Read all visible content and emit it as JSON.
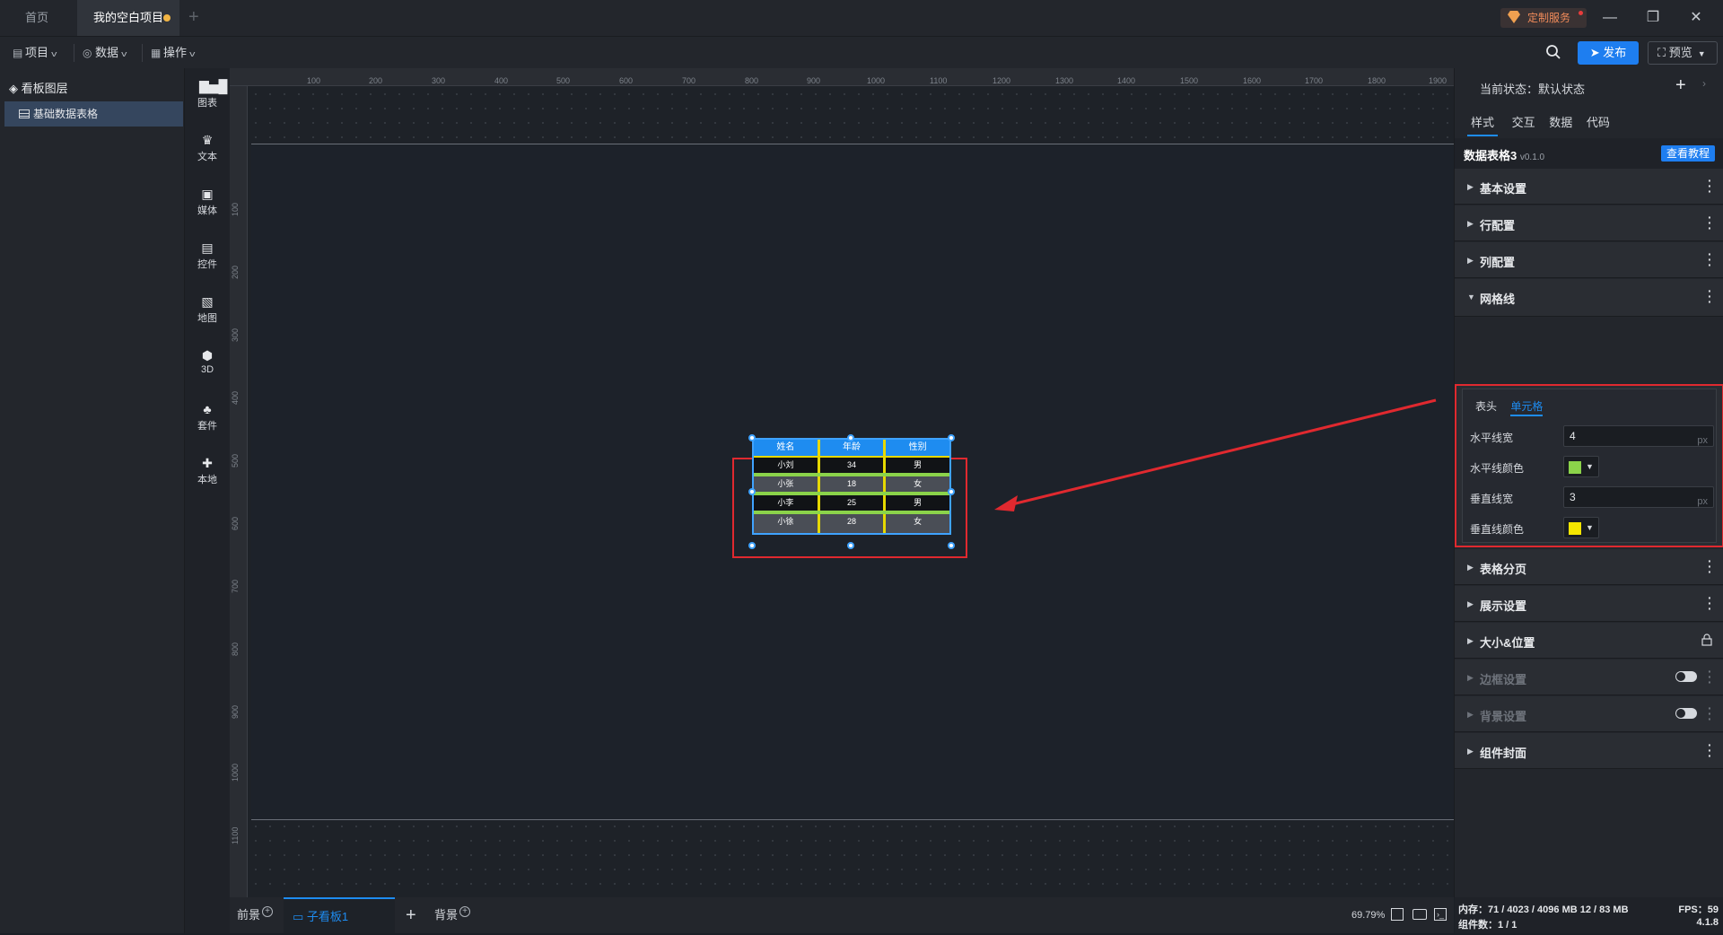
{
  "titlebar": {
    "tabs": [
      {
        "label": "首页"
      },
      {
        "label": "我的空白项目"
      }
    ],
    "custom_service": "定制服务"
  },
  "toolbar": {
    "menus": [
      {
        "label": "项目"
      },
      {
        "label": "数据"
      },
      {
        "label": "操作"
      }
    ],
    "publish": "发布",
    "preview": "预览"
  },
  "layers": {
    "title": "看板图层",
    "items": [
      {
        "label": "基础数据表格"
      }
    ]
  },
  "categories": [
    {
      "label": "图表",
      "icon": "chart-icon"
    },
    {
      "label": "文本",
      "icon": "text-icon"
    },
    {
      "label": "媒体",
      "icon": "media-icon"
    },
    {
      "label": "控件",
      "icon": "control-icon"
    },
    {
      "label": "地图",
      "icon": "map-icon"
    },
    {
      "label": "3D",
      "icon": "cube-icon"
    },
    {
      "label": "套件",
      "icon": "kit-icon"
    },
    {
      "label": "本地",
      "icon": "puzzle-icon"
    }
  ],
  "ruler": {
    "top": [
      "100",
      "200",
      "300",
      "400",
      "500",
      "600",
      "700",
      "800",
      "900",
      "1000",
      "1100",
      "1200",
      "1300",
      "1400",
      "1500",
      "1600",
      "1700",
      "1800",
      "1900"
    ],
    "left": [
      "100",
      "200",
      "300",
      "400",
      "500",
      "600",
      "700",
      "800",
      "900",
      "1000",
      "1100"
    ]
  },
  "table": {
    "headers": [
      "姓名",
      "年龄",
      "性别"
    ],
    "rows": [
      [
        "小刘",
        "34",
        "男"
      ],
      [
        "小张",
        "18",
        "女"
      ],
      [
        "小李",
        "25",
        "男"
      ],
      [
        "小徐",
        "28",
        "女"
      ]
    ],
    "colors": {
      "header_bg": "#1e8cf0",
      "horizontal_line": "#8bd34a",
      "vertical_line": "#e6d800"
    }
  },
  "bottom": {
    "foreground": "前景",
    "subboard": "子看板1",
    "background": "背景",
    "zoom": "69.79%"
  },
  "panel": {
    "state_label": "当前状态：",
    "state_value": "默认状态",
    "tabs": [
      {
        "label": "样式"
      },
      {
        "label": "交互"
      },
      {
        "label": "数据"
      },
      {
        "label": "代码"
      }
    ],
    "component_name": "数据表格3",
    "component_version": "v0.1.0",
    "tutorial": "查看教程",
    "sections_top": [
      {
        "label": "基本设置"
      },
      {
        "label": "行配置"
      },
      {
        "label": "列配置"
      },
      {
        "label": "网格线"
      }
    ],
    "gridlines": {
      "tabs": [
        {
          "label": "表头"
        },
        {
          "label": "单元格"
        }
      ],
      "fields": {
        "h_width_label": "水平线宽",
        "h_width_value": "4",
        "h_color_label": "水平线颜色",
        "v_width_label": "垂直线宽",
        "v_width_value": "3",
        "v_color_label": "垂直线颜色",
        "unit": "px",
        "h_color": "#8bd34a",
        "v_color": "#f5e600"
      }
    },
    "sections_bottom": [
      {
        "label": "表格分页"
      },
      {
        "label": "展示设置"
      },
      {
        "label": "大小&位置"
      },
      {
        "label": "边框设置"
      },
      {
        "label": "背景设置"
      },
      {
        "label": "组件封面"
      }
    ]
  },
  "status": {
    "memory": "内存：71 / 4023 / 4096 MB  12 / 83 MB",
    "count": "组件数：1 / 1",
    "fps": "FPS：59",
    "version": "4.1.8"
  }
}
